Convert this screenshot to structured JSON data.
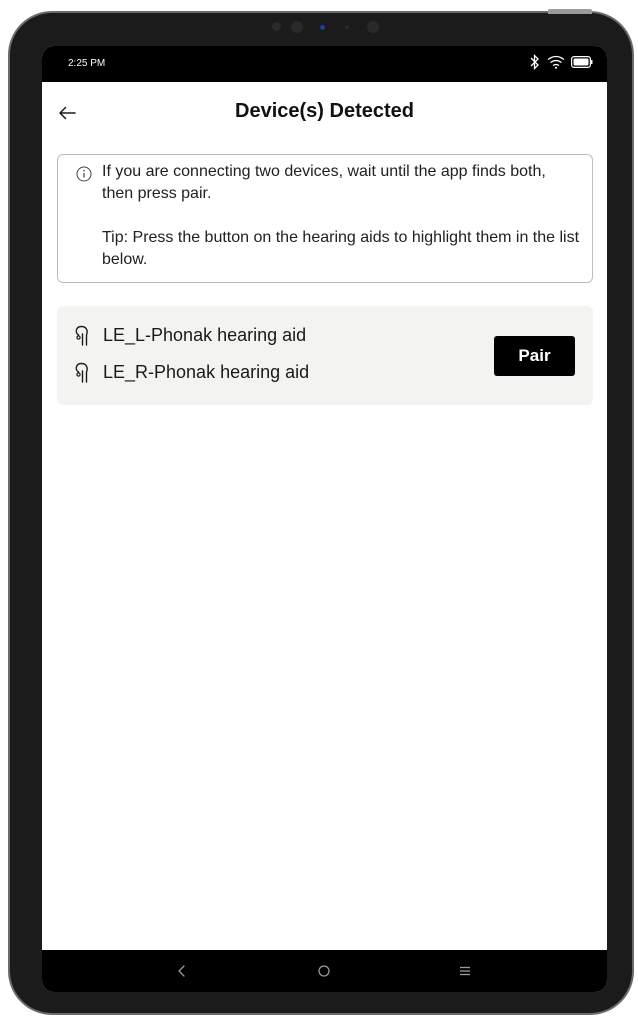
{
  "status_bar": {
    "time": "2:25 PM",
    "icons": [
      "bluetooth-icon",
      "wifi-icon",
      "battery-icon"
    ]
  },
  "header": {
    "back_icon": "arrow-left-icon",
    "title": "Device(s) Detected"
  },
  "info": {
    "icon": "info-circle-icon",
    "message": "If you are connecting two devices, wait until the app finds both, then press pair.",
    "tip": "Tip: Press the button on the hearing aids to highlight them in the list below."
  },
  "devices": {
    "items": [
      {
        "name": "LE_L-Phonak hearing aid",
        "icon": "hearing-aid-icon"
      },
      {
        "name": "LE_R-Phonak hearing aid",
        "icon": "hearing-aid-icon"
      }
    ],
    "pair_label": "Pair"
  },
  "nav": {
    "buttons": [
      "back-nav-icon",
      "home-nav-icon",
      "menu-nav-icon"
    ]
  },
  "colors": {
    "primary_button": "#000000",
    "card_background": "#f3f3f2",
    "border": "#bdbdbd",
    "text": "#111111"
  }
}
